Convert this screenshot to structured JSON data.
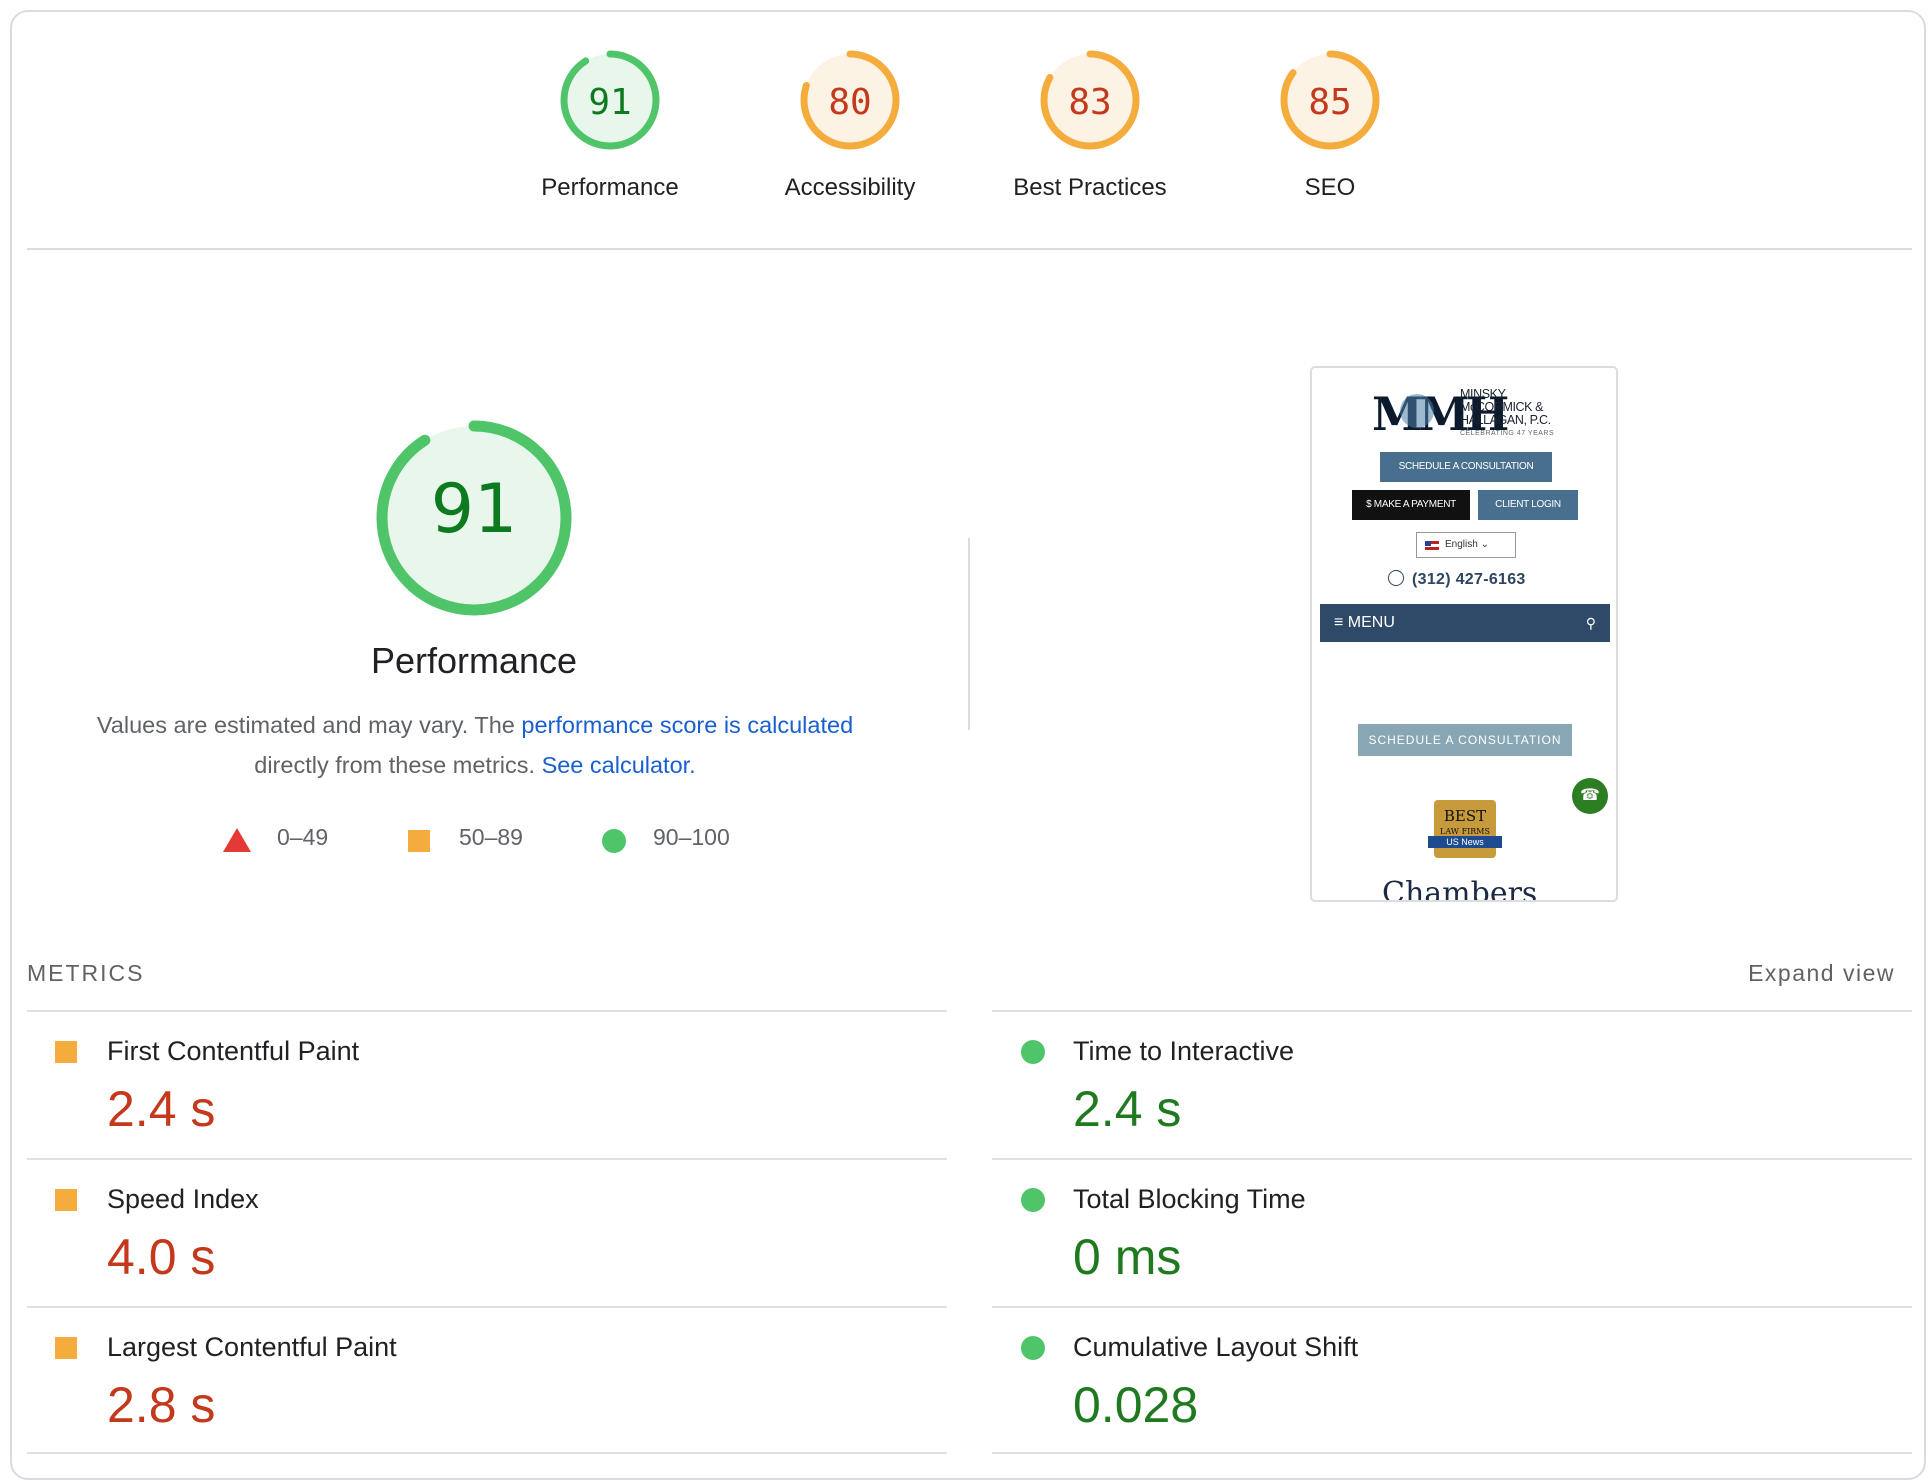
{
  "gauges": [
    {
      "score": "91",
      "label": "Performance",
      "fraction": 0.91,
      "color": "#4fc469",
      "text_color": "#0d7a1f",
      "bg": "#e9f6ec"
    },
    {
      "score": "80",
      "label": "Accessibility",
      "fraction": 0.8,
      "color": "#f4ad3d",
      "text_color": "#c4381b",
      "bg": "#fdf3e4"
    },
    {
      "score": "83",
      "label": "Best Practices",
      "fraction": 0.83,
      "color": "#f4ad3d",
      "text_color": "#c4381b",
      "bg": "#fdf3e4"
    },
    {
      "score": "85",
      "label": "SEO",
      "fraction": 0.85,
      "color": "#f4ad3d",
      "text_color": "#c4381b",
      "bg": "#fdf3e4"
    }
  ],
  "performance": {
    "score": "91",
    "fraction": 0.91,
    "title": "Performance",
    "desc_prefix": "Values are estimated and may vary. The ",
    "desc_link": "performance score is calculated",
    "desc_middle": " directly from these metrics. ",
    "desc_link2": "See calculator."
  },
  "legend": {
    "fail": "0–49",
    "average": "50–89",
    "pass": "90–100"
  },
  "thumbnail": {
    "logo_mark": "MMH",
    "logo_line1": "MINSKY",
    "logo_line2": "McCORMICK &",
    "logo_line3": "HALLAGAN, P.C.",
    "logo_sub": "CELEBRATING 47 YEARS",
    "schedule": "SCHEDULE A CONSULTATION",
    "pay": "$ MAKE A PAYMENT",
    "client": "CLIENT LOGIN",
    "language": "English",
    "phone": "(312) 427-6163",
    "menu": "≡  MENU",
    "schedule2": "SCHEDULE A CONSULTATION",
    "badge_top": "BEST",
    "badge_mid": "LAW FIRMS",
    "badge_bar": "US News",
    "chambers": "Chambers"
  },
  "metrics_section": {
    "label": "METRICS",
    "expand": "Expand view"
  },
  "metrics": [
    {
      "name": "First Contentful Paint",
      "value": "2.4 s",
      "status": "average"
    },
    {
      "name": "Time to Interactive",
      "value": "2.4 s",
      "status": "pass"
    },
    {
      "name": "Speed Index",
      "value": "4.0 s",
      "status": "average"
    },
    {
      "name": "Total Blocking Time",
      "value": "0 ms",
      "status": "pass"
    },
    {
      "name": "Largest Contentful Paint",
      "value": "2.8 s",
      "status": "average"
    },
    {
      "name": "Cumulative Layout Shift",
      "value": "0.028",
      "status": "pass"
    }
  ]
}
